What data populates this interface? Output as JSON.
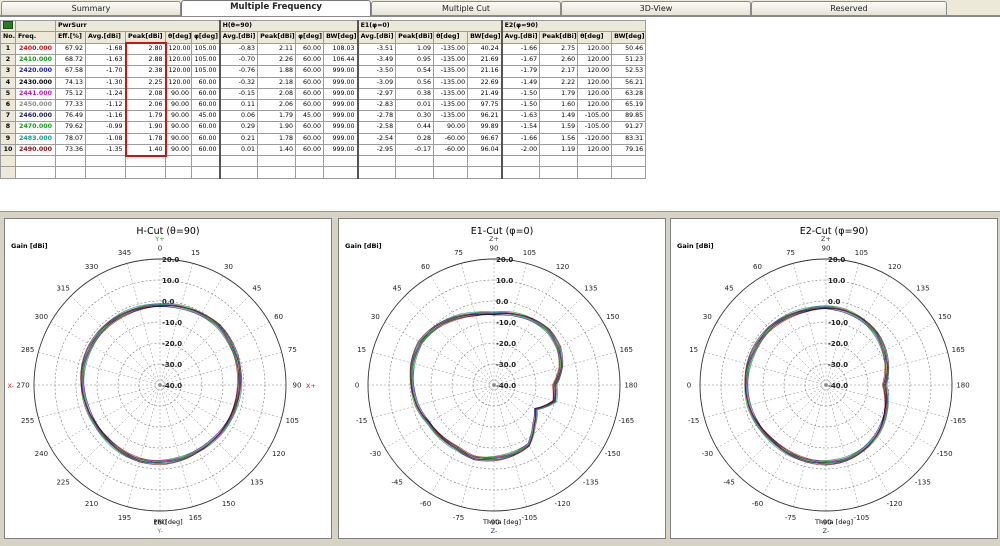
{
  "tabs": [
    {
      "label": "Summary",
      "active": false
    },
    {
      "label": "Multiple Frequency",
      "active": true
    },
    {
      "label": "Multiple Cut",
      "active": false
    },
    {
      "label": "3D-View",
      "active": false
    },
    {
      "label": "Reserved",
      "active": false
    }
  ],
  "table": {
    "group_headers": [
      "PwrSurr",
      "H(θ=90)",
      "E1(φ=0)",
      "E2(φ=90)"
    ],
    "columns": [
      "No.",
      "Freq.",
      "Eff.[%]",
      "Avg.[dBi]",
      "Peak[dBi]",
      "θ[deg]",
      "φ[deg]",
      "Avg.[dBi]",
      "Peak[dBi]",
      "φ[deg]",
      "BW[deg]",
      "Avg.[dBi]",
      "Peak[dBi]",
      "θ[deg]",
      "BW[deg]",
      "Avg.[dBi]",
      "Peak[dBi]",
      "θ[deg]",
      "BW[deg]"
    ],
    "rows": [
      {
        "no": "1",
        "freq": "2400.000",
        "color": "#d01010",
        "cells": [
          "67.92",
          "-1.68",
          "2.80",
          "120.00",
          "105.00",
          "-0.83",
          "2.11",
          "60.00",
          "108.03",
          "-3.51",
          "1.09",
          "-135.00",
          "40.24",
          "-1.66",
          "2.75",
          "120.00",
          "50.46"
        ]
      },
      {
        "no": "2",
        "freq": "2410.000",
        "color": "#129a12",
        "cells": [
          "68.72",
          "-1.63",
          "2.88",
          "120.00",
          "105.00",
          "-0.70",
          "2.26",
          "60.00",
          "106.44",
          "-3.49",
          "0.95",
          "-135.00",
          "21.69",
          "-1.67",
          "2.60",
          "120.00",
          "51.23"
        ]
      },
      {
        "no": "3",
        "freq": "2420.000",
        "color": "#1a1ab4",
        "cells": [
          "67.58",
          "-1.70",
          "2.38",
          "120.00",
          "105.00",
          "-0.76",
          "1.88",
          "60.00",
          "999.00",
          "-3.50",
          "0.54",
          "-135.00",
          "21.16",
          "-1.79",
          "2.17",
          "120.00",
          "52.53"
        ]
      },
      {
        "no": "4",
        "freq": "2430.000",
        "color": "#000000",
        "cells": [
          "74.13",
          "-1.30",
          "2.25",
          "120.00",
          "60.00",
          "-0.32",
          "2.18",
          "60.00",
          "999.00",
          "-3.09",
          "0.56",
          "-135.00",
          "22.69",
          "-1.49",
          "2.22",
          "120.00",
          "56.21"
        ]
      },
      {
        "no": "5",
        "freq": "2441.000",
        "color": "#c010c0",
        "cells": [
          "75.12",
          "-1.24",
          "2.08",
          "90.00",
          "60.00",
          "-0.15",
          "2.08",
          "60.00",
          "999.00",
          "-2.97",
          "0.38",
          "-135.00",
          "21.49",
          "-1.50",
          "1.79",
          "120.00",
          "63.28"
        ]
      },
      {
        "no": "6",
        "freq": "2450.000",
        "color": "#8a8a8a",
        "cells": [
          "77.33",
          "-1.12",
          "2.06",
          "90.00",
          "60.00",
          "0.11",
          "2.06",
          "60.00",
          "999.00",
          "-2.83",
          "0.01",
          "-135.00",
          "97.75",
          "-1.50",
          "1.60",
          "120.00",
          "65.19"
        ]
      },
      {
        "no": "7",
        "freq": "2460.000",
        "color": "#20205a",
        "cells": [
          "76.49",
          "-1.16",
          "1.79",
          "90.00",
          "45.00",
          "0.06",
          "1.79",
          "45.00",
          "999.00",
          "-2.78",
          "0.30",
          "-135.00",
          "96.21",
          "-1.63",
          "1.49",
          "-105.00",
          "89.85"
        ]
      },
      {
        "no": "8",
        "freq": "2470.000",
        "color": "#18a018",
        "cells": [
          "79.62",
          "-0.99",
          "1.90",
          "90.00",
          "60.00",
          "0.29",
          "1.90",
          "60.00",
          "999.00",
          "-2.58",
          "0.44",
          "90.00",
          "99.89",
          "-1.54",
          "1.59",
          "-105.00",
          "91.27"
        ]
      },
      {
        "no": "9",
        "freq": "2483.000",
        "color": "#109a9a",
        "cells": [
          "78.07",
          "-1.08",
          "1.78",
          "90.00",
          "60.00",
          "0.21",
          "1.78",
          "60.00",
          "999.00",
          "-2.54",
          "0.28",
          "-60.00",
          "96.67",
          "-1.66",
          "1.56",
          "-120.00",
          "83.31"
        ]
      },
      {
        "no": "10",
        "freq": "2490.000",
        "color": "#8a1010",
        "cells": [
          "73.36",
          "-1.35",
          "1.40",
          "90.00",
          "60.00",
          "0.01",
          "1.40",
          "60.00",
          "999.00",
          "-2.95",
          "-0.17",
          "-60.00",
          "96.04",
          "-2.00",
          "1.19",
          "120.00",
          "79.16"
        ]
      }
    ]
  },
  "plots": [
    {
      "title": "H-Cut (θ=90)",
      "gain_label": "Gain [dBi]",
      "axis_label": "Phi [deg]",
      "angle_labels": [
        "0",
        "15",
        "30",
        "45",
        "60",
        "75",
        "90",
        "105",
        "120",
        "135",
        "150",
        "165",
        "180",
        "195",
        "210",
        "225",
        "240",
        "255",
        "270",
        "285",
        "300",
        "315",
        "330",
        "345"
      ],
      "dir_labels": {
        "top": "Y+",
        "bottom": "Y-",
        "left": "X-",
        "right": "X+"
      },
      "radial_labels": [
        "20.0",
        "10.0",
        "0.0",
        "-10.0",
        "-20.0",
        "-30.0",
        "-40.0"
      ]
    },
    {
      "title": "E1-Cut (φ=0)",
      "gain_label": "Gain [dBi]",
      "axis_label": "Theta [deg]",
      "angle_labels": [
        "90",
        "105",
        "120",
        "135",
        "150",
        "165",
        "180",
        "-165",
        "-150",
        "-135",
        "-120",
        "-105",
        "-90",
        "-75",
        "-60",
        "-45",
        "-30",
        "-15",
        "0",
        "15",
        "30",
        "45",
        "60",
        "75"
      ],
      "dir_labels": {
        "top": "Z+",
        "bottom": "Z-",
        "left": "",
        "right": ""
      },
      "radial_labels": [
        "20.0",
        "10.0",
        "0.0",
        "-10.0",
        "-20.0",
        "-30.0",
        "-40.0"
      ]
    },
    {
      "title": "E2-Cut (φ=90)",
      "gain_label": "Gain [dBi]",
      "axis_label": "Theta [deg]",
      "angle_labels": [
        "90",
        "105",
        "120",
        "135",
        "150",
        "165",
        "180",
        "-165",
        "-150",
        "-135",
        "-120",
        "-105",
        "-90",
        "-75",
        "-60",
        "-45",
        "-30",
        "-15",
        "0",
        "15",
        "30",
        "45",
        "60",
        "75"
      ],
      "dir_labels": {
        "top": "Z+",
        "bottom": "Z-",
        "left": "",
        "right": ""
      },
      "radial_labels": [
        "20.0",
        "10.0",
        "0.0",
        "-10.0",
        "-20.0",
        "-30.0",
        "-40.0"
      ]
    }
  ],
  "chart_data": [
    {
      "type": "scatter",
      "polar": true,
      "title": "H-Cut (θ=90)",
      "ylabel": "Gain [dBi]",
      "xlabel": "Phi [deg]",
      "rlim": [
        -40,
        20
      ],
      "series": [
        {
          "values": [
            -2,
            -1.5,
            -1,
            -0.5,
            -1,
            -1.5,
            -2,
            -2.5,
            -3,
            -3.5,
            -3.8,
            -3.6,
            -3.2,
            -3,
            -3.3,
            -3.8,
            -4,
            -3.6,
            -3,
            -2.5,
            -2.2,
            -2,
            -2,
            -2
          ]
        }
      ]
    },
    {
      "type": "scatter",
      "polar": true,
      "title": "E1-Cut (φ=0)",
      "ylabel": "Gain [dBi]",
      "xlabel": "Theta [deg]",
      "rlim": [
        -40,
        20
      ],
      "series": [
        {
          "values": [
            -6,
            -5,
            -4,
            -3.5,
            -4.5,
            -7,
            -11,
            -10,
            -17,
            -13,
            -7,
            -6,
            -5,
            -4,
            -5,
            -4.5,
            -4,
            -2,
            -1,
            0,
            0.5,
            -1,
            -3,
            -5
          ]
        }
      ]
    },
    {
      "type": "scatter",
      "polar": true,
      "title": "E2-Cut (φ=90)",
      "ylabel": "Gain [dBi]",
      "xlabel": "Theta [deg]",
      "rlim": [
        -40,
        20
      ],
      "series": [
        {
          "values": [
            -3,
            -3.5,
            -4.5,
            -6,
            -8,
            -10,
            -12,
            -10,
            -8,
            -6,
            -4.5,
            -3.5,
            -3,
            -3,
            -3,
            -3,
            -2.5,
            -2,
            -2,
            -2,
            -2,
            -2,
            -2.5,
            -3
          ]
        }
      ]
    }
  ]
}
